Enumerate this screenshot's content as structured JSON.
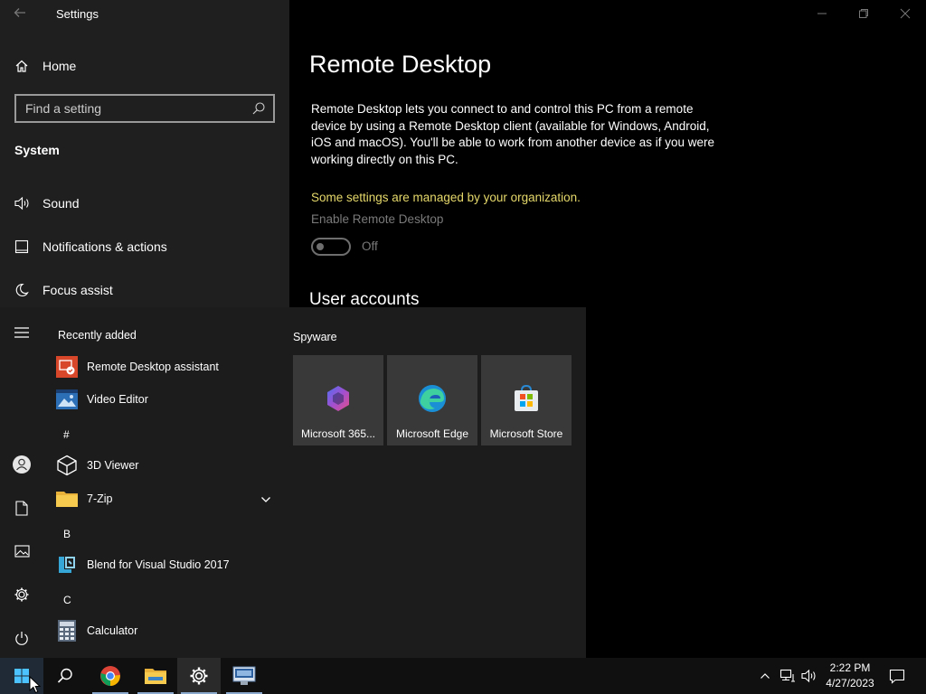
{
  "window": {
    "title": "Settings",
    "back_icon": "back-arrow-icon",
    "controls": [
      "minimize-icon",
      "maximize-icon",
      "close-icon"
    ]
  },
  "sidebar": {
    "home_label": "Home",
    "search_placeholder": "Find a setting",
    "section_title": "System",
    "items": [
      {
        "label": "Sound",
        "icon": "speaker-icon"
      },
      {
        "label": "Notifications & actions",
        "icon": "notification-icon"
      },
      {
        "label": "Focus assist",
        "icon": "moon-icon"
      }
    ]
  },
  "main": {
    "page_title": "Remote Desktop",
    "description": "Remote Desktop lets you connect to and control this PC from a remote device by using a Remote Desktop client (available for Windows, Android, iOS and macOS). You'll be able to work from another device as if you were working directly on this PC.",
    "managed_notice": "Some settings are managed by your organization.",
    "enable_label": "Enable Remote Desktop",
    "toggle_state": "Off",
    "toggle_on": false,
    "user_accounts_title": "User accounts",
    "managed_color": "#e6d96b"
  },
  "start_menu": {
    "recently_added_label": "Recently added",
    "recent_apps": [
      {
        "label": "Remote Desktop assistant",
        "icon": "remote-desktop-assistant-icon"
      },
      {
        "label": "Video Editor",
        "icon": "video-editor-icon"
      }
    ],
    "groups": [
      {
        "letter": "#",
        "apps": [
          {
            "label": "3D Viewer",
            "icon": "cube-icon"
          },
          {
            "label": "7-Zip",
            "icon": "folder-icon",
            "expandable": true
          }
        ]
      },
      {
        "letter": "B",
        "apps": [
          {
            "label": "Blend for Visual Studio 2017",
            "icon": "blend-icon"
          }
        ]
      },
      {
        "letter": "C",
        "apps": [
          {
            "label": "Calculator",
            "icon": "calculator-icon"
          }
        ]
      }
    ],
    "tile_group_title": "Spyware",
    "tiles": [
      {
        "label": "Microsoft 365...",
        "icon": "microsoft-365-icon"
      },
      {
        "label": "Microsoft Edge",
        "icon": "edge-icon"
      },
      {
        "label": "Microsoft Store",
        "icon": "store-icon"
      }
    ],
    "rail_icons": [
      "hamburger-icon",
      "user-icon",
      "document-icon",
      "pictures-icon",
      "settings-icon",
      "power-icon"
    ]
  },
  "taskbar": {
    "pinned": [
      "windows-start-icon",
      "search-icon",
      "chrome-icon",
      "file-explorer-icon",
      "settings-icon",
      "remote-desktop-icon"
    ],
    "tray_icons": [
      "chevron-up-icon",
      "network-icon",
      "volume-icon",
      "action-center-icon"
    ],
    "time": "2:22 PM",
    "date": "4/27/2023",
    "active_color": "#8aa9cc"
  }
}
